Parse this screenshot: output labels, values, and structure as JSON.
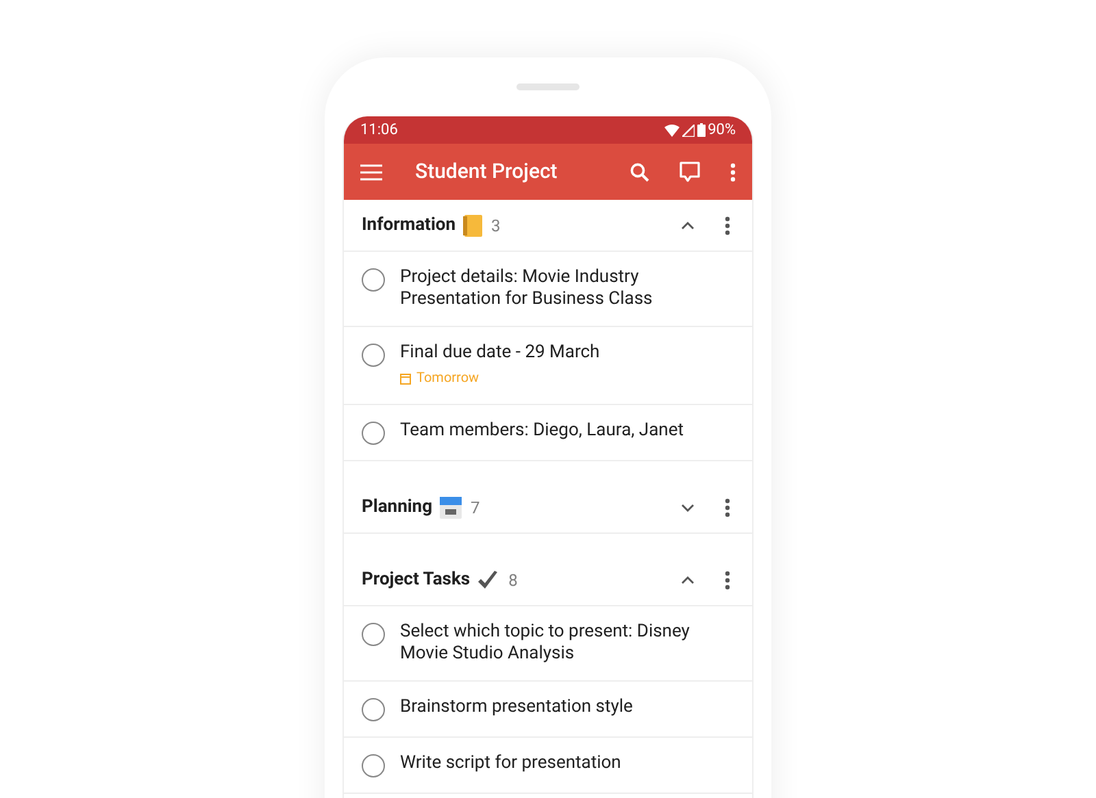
{
  "status_bar": {
    "time": "11:06",
    "battery": "90%"
  },
  "toolbar": {
    "title": "Student Project"
  },
  "sections": [
    {
      "name": "Information",
      "kind": "notebook",
      "count": "3",
      "expanded": true,
      "tasks": [
        {
          "text": "Project details: Movie Industry Presentation for Business Class",
          "checked": false
        },
        {
          "text": "Final due date - 29 March",
          "checked": false,
          "due": "Tomorrow"
        },
        {
          "text": "Team members: Diego, Laura, Janet",
          "checked": false
        }
      ]
    },
    {
      "name": "Planning",
      "kind": "calendar",
      "count": "7",
      "expanded": false
    },
    {
      "name": "Project Tasks",
      "kind": "check",
      "count": "8",
      "expanded": true,
      "tasks": [
        {
          "text": "Select which topic to present: Disney Movie Studio Analysis",
          "checked": false
        },
        {
          "text": "Brainstorm presentation style",
          "checked": false
        },
        {
          "text": "Write script for presentation",
          "checked": false
        }
      ]
    }
  ]
}
